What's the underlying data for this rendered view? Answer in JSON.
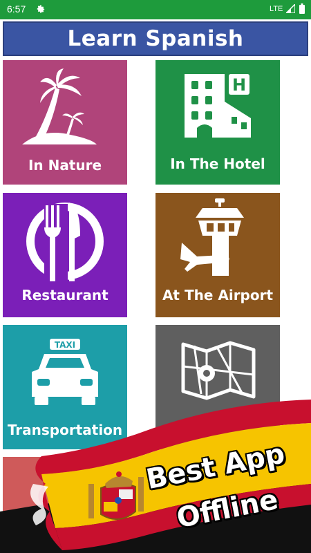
{
  "status_bar": {
    "time": "6:57",
    "network": "LTE",
    "icons": [
      "gear-icon",
      "signal-icon",
      "battery-icon"
    ],
    "background": "#1e9b3c"
  },
  "header": {
    "title": "Learn Spanish",
    "background": "#3a55a3"
  },
  "tiles": [
    {
      "label": "In Nature",
      "color": "#b0447a",
      "icon": "palm-island-icon"
    },
    {
      "label": "In The Hotel",
      "color": "#1f9147",
      "icon": "hotel-building-icon"
    },
    {
      "label": "Restaurant",
      "color": "#7b1fb8",
      "icon": "plate-fork-knife-icon"
    },
    {
      "label": "At The Airport",
      "color": "#8a551d",
      "icon": "control-tower-plane-icon"
    },
    {
      "label": "Transportation",
      "color": "#1d9ea8",
      "icon": "taxi-icon"
    },
    {
      "label": "",
      "color": "#5f5f5f",
      "icon": "map-icon"
    },
    {
      "label": "",
      "color": "#cf5a5a",
      "icon": ""
    }
  ],
  "promo": {
    "line1": "Best App",
    "line2": "Offline",
    "flag_colors": {
      "red": "#c8102e",
      "yellow": "#f6c400"
    },
    "icon": "spain-coat-of-arms-icon"
  }
}
